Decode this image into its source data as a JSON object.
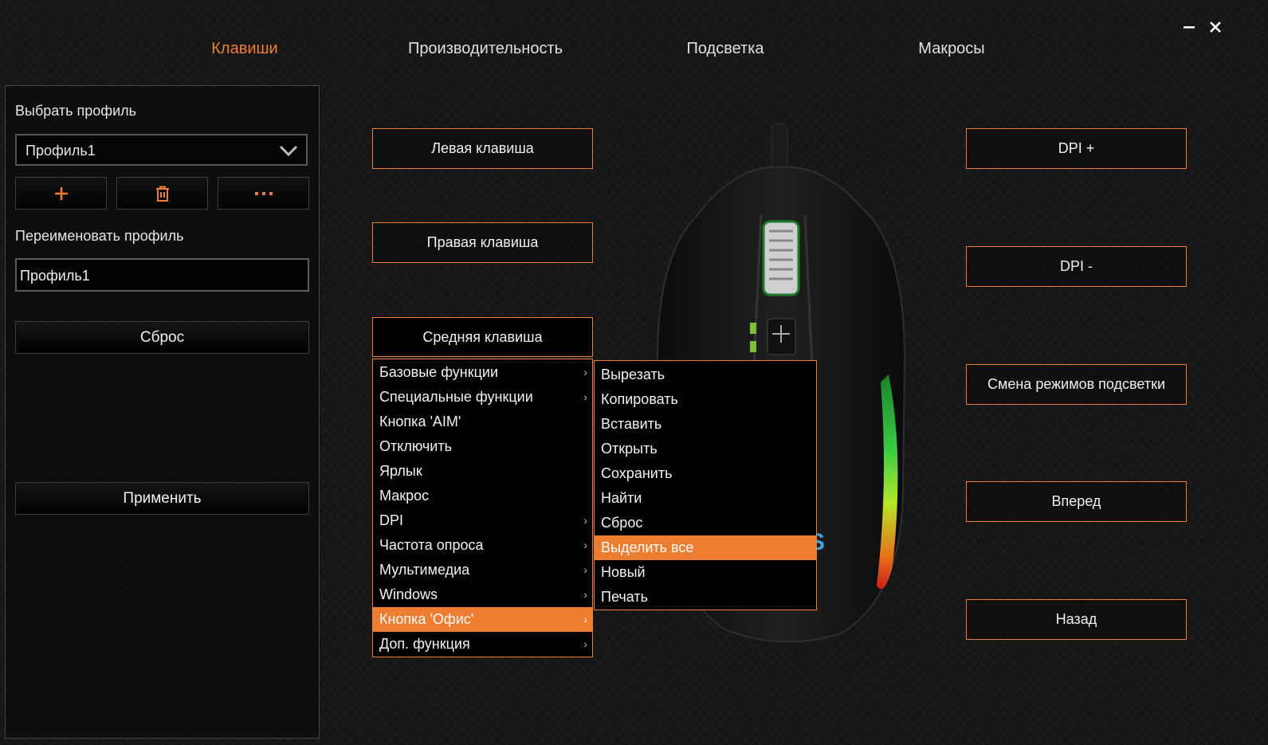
{
  "tabs": [
    {
      "label": "Клавиши",
      "active": true
    },
    {
      "label": "Производительность",
      "active": false
    },
    {
      "label": "Подсветка",
      "active": false
    },
    {
      "label": "Макросы",
      "active": false
    }
  ],
  "window": {
    "minimize_icon": "minimize-icon",
    "close_icon": "close-icon"
  },
  "profile_panel": {
    "select_label": "Выбрать профиль",
    "selected_profile": "Профиль1",
    "icon_buttons": [
      "plus-icon",
      "trash-icon",
      "more-icon"
    ],
    "rename_label": "Переименовать профиль",
    "rename_value": "Профиль1",
    "reset_label": "Сброс",
    "apply_label": "Применить"
  },
  "left_buttons": {
    "left_key": "Левая клавиша",
    "right_key": "Правая клавиша",
    "middle_key": "Средняя клавиша"
  },
  "right_buttons": {
    "dpi_plus": "DPI +",
    "dpi_minus": "DPI -",
    "light_mode": "Смена режимов подсветки",
    "forward": "Вперед",
    "back": "Назад"
  },
  "function_menu": {
    "items": [
      {
        "label": "Базовые функции",
        "submenu": true
      },
      {
        "label": "Специальные функции",
        "submenu": true
      },
      {
        "label": "Кнопка 'AIM'",
        "submenu": false
      },
      {
        "label": "Отключить",
        "submenu": false
      },
      {
        "label": "Ярлык",
        "submenu": false
      },
      {
        "label": "Макрос",
        "submenu": false
      },
      {
        "label": "DPI",
        "submenu": true
      },
      {
        "label": "Частота опроса",
        "submenu": true
      },
      {
        "label": "Мультимедиа",
        "submenu": true
      },
      {
        "label": "Windows",
        "submenu": true
      },
      {
        "label": "Кнопка 'Офис'",
        "submenu": true,
        "highlighted": true
      },
      {
        "label": "Доп. функция",
        "submenu": true
      }
    ]
  },
  "office_submenu": {
    "items": [
      {
        "label": "Вырезать"
      },
      {
        "label": "Копировать"
      },
      {
        "label": "Вставить"
      },
      {
        "label": "Открыть"
      },
      {
        "label": "Сохранить"
      },
      {
        "label": "Найти"
      },
      {
        "label": "Сброс"
      },
      {
        "label": "Выделить все",
        "highlighted": true
      },
      {
        "label": "Новый"
      },
      {
        "label": "Печать"
      }
    ]
  },
  "colors": {
    "accent": "#ed7d31",
    "background": "#161616",
    "menu_bg": "#000000"
  },
  "device_image": "gaming-mouse-image"
}
